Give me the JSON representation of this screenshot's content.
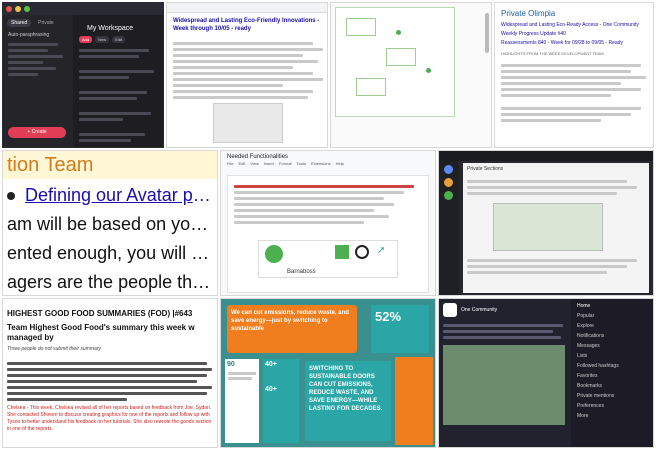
{
  "tile1": {
    "tabs": [
      "Shared",
      "Private"
    ],
    "panel_title": "My Workspace",
    "create_label": "Create",
    "sidebar": [
      "Auto-paraphrasing"
    ],
    "items": [
      "Add",
      "New",
      "Edit"
    ],
    "accent": "#e23d56"
  },
  "tile2": {
    "heading": "Widespread and Lasting Eco-Friendly Innovations - Week through 10/05 - ready",
    "accent": "#1a0dab"
  },
  "tile3": {},
  "tile4": {
    "brand": "Private Olimpia",
    "lines": [
      "Widespread and Lasting Eco-Ready Access - One Community",
      "Weekly Progress Update #40",
      "Reassessments 840 - Week for 09/28 to 09/05 - Ready"
    ],
    "subhead": "HIGHLIGHTS FROM THE WEEK DEVELOPMENT TEAM"
  },
  "tile5": {
    "line1": "tion Team",
    "line2": "Defining our Avatar page",
    "line3": "am will be based on your abiliti",
    "line4": "ented enough, you will get pror",
    "line5": "agers are the people that work"
  },
  "tile6": {
    "doc_title": "Needed Functionalities",
    "menu": [
      "File",
      "Edit",
      "View",
      "Insert",
      "Format",
      "Tools",
      "Extensions",
      "Help"
    ],
    "item_title": "Barnaboss",
    "accent": "#4caf50"
  },
  "tile7": {
    "site": "Private Sections"
  },
  "tile8": {
    "title": "HIGHEST GOOD FOOD SUMMARIES (FOD) |#643",
    "sub": "Team Highest Good Food's summary this week w managed by",
    "note": "Three people do not submit their summary",
    "red_para": "Chelsea - This week, Chelsea revised all of her reports based on feedback from Joe. Sydon. She contacted Shireen to discuss creating graphics for one of the reports and follow up with Tyson to better understand his feedback on her tutorials. She also rewrote the goods section in one of the reports."
  },
  "tile9": {
    "box1": "We can cut emissions, reduce waste, and save energy—just by switching to sustainable",
    "stat": "52%",
    "box2": "SWITCHING TO SUSTAINABLE DOORS CAN CUT EMISSIONS, REDUCE WASTE, AND SAVE ENERGY—WHILE LASTING FOR DECADES.",
    "side1": "40+",
    "side2": "40+",
    "side3": "90",
    "orange": "#f07d1e",
    "teal": "#2aa6a6"
  },
  "tile10": {
    "community": "One Community",
    "nav": [
      "Home",
      "Popular",
      "Explore",
      "Notifications",
      "Messages",
      "Lists",
      "Followed hashtags",
      "Favorites",
      "Bookmarks",
      "Private mentions",
      "Preferences",
      "More"
    ]
  }
}
